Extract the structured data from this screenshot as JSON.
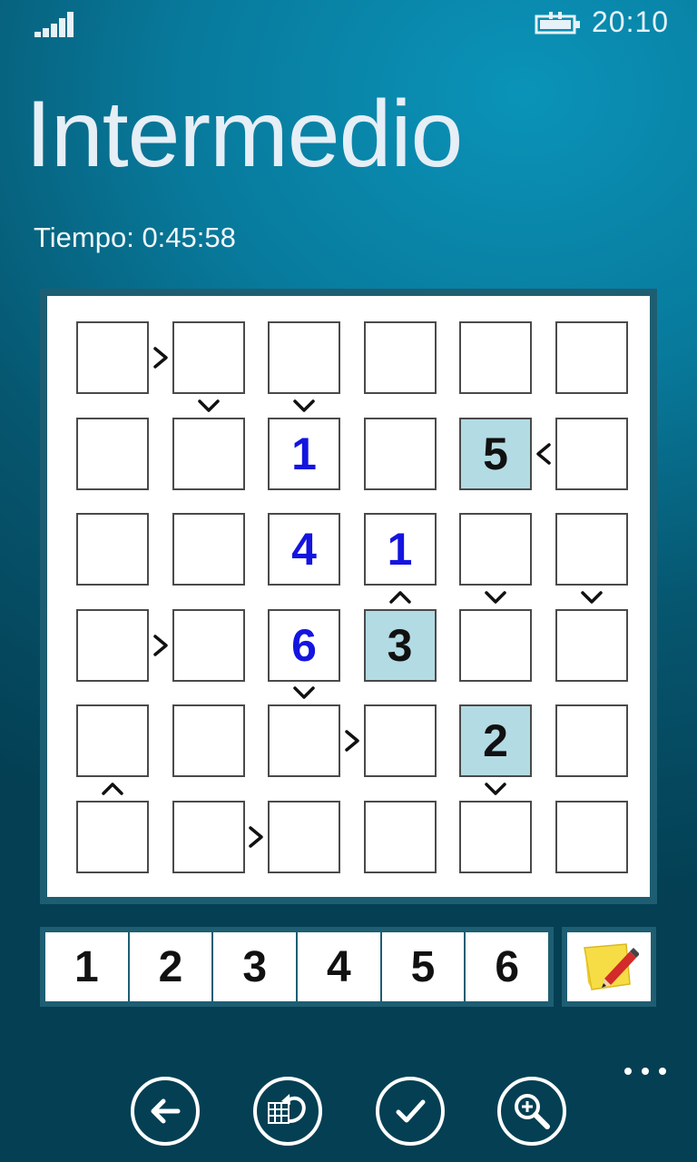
{
  "status": {
    "time": "20:10"
  },
  "header": {
    "title": "Intermedio",
    "timer": "Tiempo: 0:45:58"
  },
  "board": {
    "size": 6,
    "cells": [
      [
        "",
        "",
        "",
        "",
        "",
        ""
      ],
      [
        "",
        "",
        "1",
        "",
        "5",
        ""
      ],
      [
        "",
        "",
        "4",
        "1",
        "",
        ""
      ],
      [
        "",
        "",
        "6",
        "3",
        "",
        ""
      ],
      [
        "",
        "",
        "",
        "",
        "2",
        ""
      ],
      [
        "",
        "",
        "",
        "",
        "",
        ""
      ]
    ],
    "given": [
      [
        1,
        4
      ],
      [
        3,
        3
      ],
      [
        4,
        4
      ]
    ],
    "colors": {
      "given_bg": "#b3dbe4",
      "user_digit": "#1414e0",
      "given_digit": "#111111"
    },
    "horizontal_signs": [
      {
        "row": 0,
        "left_col": 0,
        "sign": ">"
      },
      {
        "row": 1,
        "left_col": 4,
        "sign": "<"
      },
      {
        "row": 3,
        "left_col": 0,
        "sign": ">"
      },
      {
        "row": 4,
        "left_col": 2,
        "sign": ">"
      },
      {
        "row": 5,
        "left_col": 1,
        "sign": ">"
      }
    ],
    "vertical_signs": [
      {
        "top_row": 0,
        "col": 1,
        "sign": "v"
      },
      {
        "top_row": 0,
        "col": 2,
        "sign": "v"
      },
      {
        "top_row": 2,
        "col": 3,
        "sign": "^"
      },
      {
        "top_row": 2,
        "col": 4,
        "sign": "v"
      },
      {
        "top_row": 2,
        "col": 5,
        "sign": "v"
      },
      {
        "top_row": 3,
        "col": 2,
        "sign": "v"
      },
      {
        "top_row": 4,
        "col": 0,
        "sign": "^"
      },
      {
        "top_row": 4,
        "col": 4,
        "sign": "v"
      }
    ]
  },
  "numpad": {
    "keys": [
      "1",
      "2",
      "3",
      "4",
      "5",
      "6"
    ],
    "note_icon": "sticky-note-pencil-icon"
  },
  "appbar": {
    "buttons": [
      {
        "id": "back",
        "icon": "back-arrow-icon"
      },
      {
        "id": "undo",
        "icon": "undo-icon"
      },
      {
        "id": "check",
        "icon": "checkmark-icon"
      },
      {
        "id": "zoom",
        "icon": "zoom-in-icon"
      }
    ],
    "more_icon": "ellipsis-icon"
  }
}
